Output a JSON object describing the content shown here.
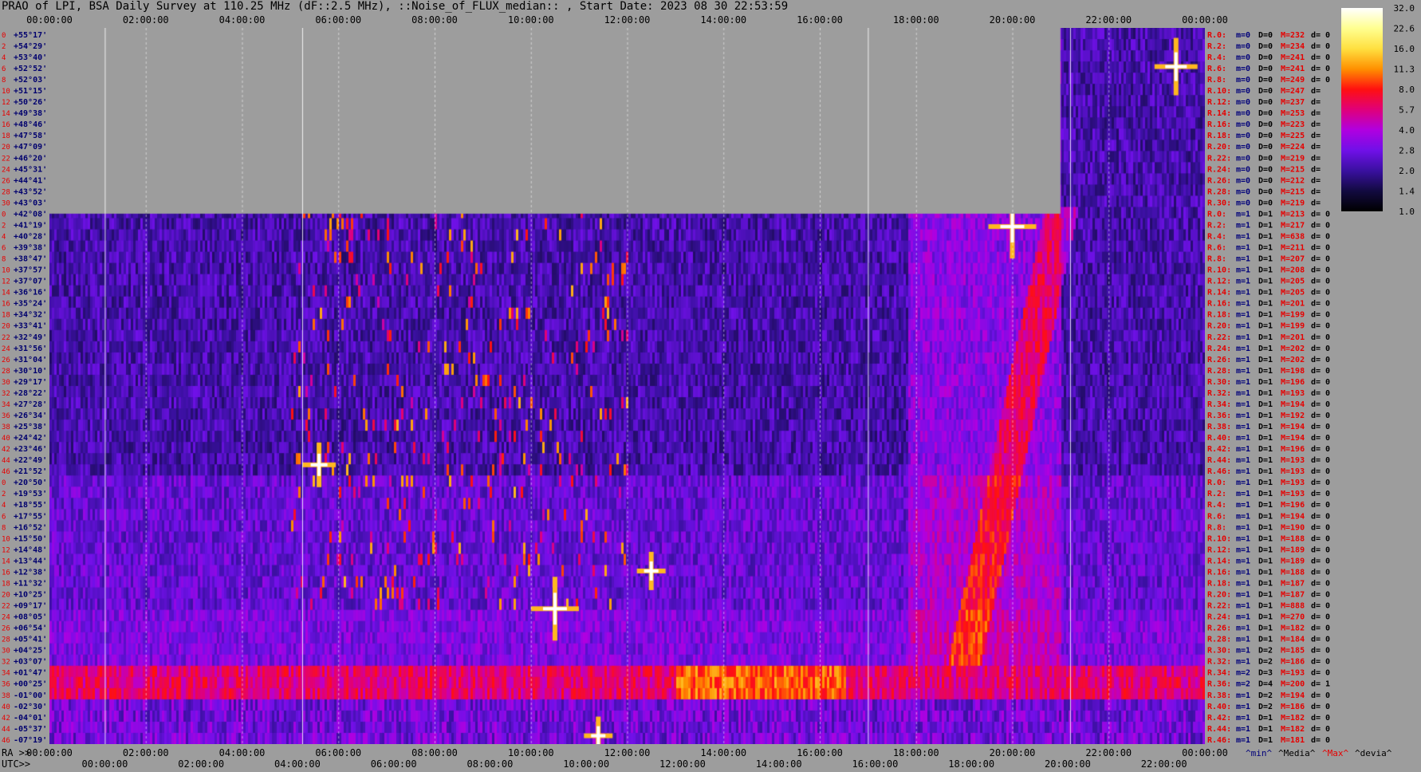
{
  "title": "PRAO of LPI, BSA Daily Survey at 110.25 MHz (dF::2.5 MHz), ::Noise_of_FLUX_median:: , Start Date: 2023 08 30 22:53:59",
  "colors": {
    "background": "#9d9d9d",
    "row_label": "#e60000",
    "dec_label": "#00006e",
    "m_label": "#00007a",
    "D_label": "#000000",
    "M_label": "#e60000"
  },
  "chart_data": {
    "type": "heatmap",
    "title": "PRAO of LPI, BSA Daily Survey at 110.25 MHz (dF::2.5 MHz), ::Noise_of_FLUX_median:: , Start Date: 2023 08 30 22:53:59",
    "top_x_ticks": [
      "00:00:00",
      "02:00:00",
      "04:00:00",
      "06:00:00",
      "08:00:00",
      "10:00:00",
      "12:00:00",
      "14:00:00",
      "16:00:00",
      "18:00:00",
      "20:00:00",
      "22:00:00",
      "00:00:00"
    ],
    "bottom_ra_label": "RA >>",
    "bottom_ra_ticks": [
      "00:00:00",
      "02:00:00",
      "04:00:00",
      "06:00:00",
      "08:00:00",
      "10:00:00",
      "12:00:00",
      "14:00:00",
      "16:00:00",
      "18:00:00",
      "20:00:00",
      "22:00:00",
      "00:00:00"
    ],
    "bottom_utc_label": "UTC>>",
    "bottom_utc_ticks": [
      "00:00:00",
      "02:00:00",
      "04:00:00",
      "06:00:00",
      "08:00:00",
      "10:00:00",
      "12:00:00",
      "14:00:00",
      "16:00:00",
      "18:00:00",
      "20:00:00",
      "22:00:00"
    ],
    "declinations": [
      "+55°17'",
      "+54°29'",
      "+53°40'",
      "+52°52'",
      "+52°03'",
      "+51°15'",
      "+50°26'",
      "+49°38'",
      "+48°46'",
      "+47°58'",
      "+47°09'",
      "+46°20'",
      "+45°31'",
      "+44°41'",
      "+43°52'",
      "+43°03'",
      "+42°08'",
      "+41°19'",
      "+40°28'",
      "+39°38'",
      "+38°47'",
      "+37°57'",
      "+37°07'",
      "+36°16'",
      "+35°24'",
      "+34°32'",
      "+33°41'",
      "+32°49'",
      "+31°56'",
      "+31°04'",
      "+30°10'",
      "+29°17'",
      "+28°22'",
      "+27°28'",
      "+26°34'",
      "+25°38'",
      "+24°42'",
      "+23°46'",
      "+22°49'",
      "+21°52'",
      "+20°50'",
      "+19°53'",
      "+18°55'",
      "+17°55'",
      "+16°52'",
      "+15°50'",
      "+14°48'",
      "+13°44'",
      "+12°38'",
      "+11°32'",
      "+10°25'",
      "+09°17'",
      "+08°05'",
      "+06°54'",
      "+05°41'",
      "+04°25'",
      "+03°07'",
      "+01°47'",
      "+00°25'",
      "-01°00'",
      "-02°30'",
      "-04°01'",
      "-05°37'",
      "-07°19'"
    ],
    "row_index_labels": [
      "0",
      "2",
      "4",
      "6",
      "8",
      "10",
      "12",
      "14",
      "16",
      "18",
      "20",
      "22",
      "24",
      "26",
      "28",
      "30",
      "0",
      "2",
      "4",
      "6",
      "8",
      "10",
      "12",
      "14",
      "16",
      "18",
      "20",
      "22",
      "24",
      "26",
      "28",
      "30",
      "32",
      "34",
      "36",
      "38",
      "40",
      "42",
      "44",
      "46",
      "0",
      "2",
      "4",
      "6",
      "8",
      "10",
      "12",
      "14",
      "16",
      "18",
      "20",
      "22",
      "24",
      "26",
      "28",
      "30",
      "32",
      "34",
      "36",
      "38",
      "40",
      "42",
      "44",
      "46"
    ],
    "stats_rows": [
      {
        "r": "R.0:",
        "m": "m=0",
        "d": "D=0",
        "M": "M=232",
        "dv": "d= 0"
      },
      {
        "r": "R.2:",
        "m": "m=0",
        "d": "D=0",
        "M": "M=234",
        "dv": "d= 0"
      },
      {
        "r": "R.4:",
        "m": "m=0",
        "d": "D=0",
        "M": "M=241",
        "dv": "d= 0"
      },
      {
        "r": "R.6:",
        "m": "m=0",
        "d": "D=0",
        "M": "M=241",
        "dv": "d= 0"
      },
      {
        "r": "R.8:",
        "m": "m=0",
        "d": "D=0",
        "M": "M=249",
        "dv": "d= 0"
      },
      {
        "r": "R.10:",
        "m": "m=0",
        "d": "D=0",
        "M": "M=247",
        "dv": "d="
      },
      {
        "r": "R.12:",
        "m": "m=0",
        "d": "D=0",
        "M": "M=237",
        "dv": "d="
      },
      {
        "r": "R.14:",
        "m": "m=0",
        "d": "D=0",
        "M": "M=253",
        "dv": "d="
      },
      {
        "r": "R.16:",
        "m": "m=0",
        "d": "D=0",
        "M": "M=223",
        "dv": "d="
      },
      {
        "r": "R.18:",
        "m": "m=0",
        "d": "D=0",
        "M": "M=225",
        "dv": "d="
      },
      {
        "r": "R.20:",
        "m": "m=0",
        "d": "D=0",
        "M": "M=224",
        "dv": "d="
      },
      {
        "r": "R.22:",
        "m": "m=0",
        "d": "D=0",
        "M": "M=219",
        "dv": "d="
      },
      {
        "r": "R.24:",
        "m": "m=0",
        "d": "D=0",
        "M": "M=215",
        "dv": "d="
      },
      {
        "r": "R.26:",
        "m": "m=0",
        "d": "D=0",
        "M": "M=212",
        "dv": "d="
      },
      {
        "r": "R.28:",
        "m": "m=0",
        "d": "D=0",
        "M": "M=215",
        "dv": "d="
      },
      {
        "r": "R.30:",
        "m": "m=0",
        "d": "D=0",
        "M": "M=219",
        "dv": "d="
      },
      {
        "r": "R.0:",
        "m": "m=1",
        "d": "D=1",
        "M": "M=213",
        "dv": "d= 0"
      },
      {
        "r": "R.2:",
        "m": "m=1",
        "d": "D=1",
        "M": "M=217",
        "dv": "d= 0"
      },
      {
        "r": "R.4:",
        "m": "m=1",
        "d": "D=1",
        "M": "M=638",
        "dv": "d= 0"
      },
      {
        "r": "R.6:",
        "m": "m=1",
        "d": "D=1",
        "M": "M=211",
        "dv": "d= 0"
      },
      {
        "r": "R.8:",
        "m": "m=1",
        "d": "D=1",
        "M": "M=207",
        "dv": "d= 0"
      },
      {
        "r": "R.10:",
        "m": "m=1",
        "d": "D=1",
        "M": "M=208",
        "dv": "d= 0"
      },
      {
        "r": "R.12:",
        "m": "m=1",
        "d": "D=1",
        "M": "M=205",
        "dv": "d= 0"
      },
      {
        "r": "R.14:",
        "m": "m=1",
        "d": "D=1",
        "M": "M=205",
        "dv": "d= 0"
      },
      {
        "r": "R.16:",
        "m": "m=1",
        "d": "D=1",
        "M": "M=201",
        "dv": "d= 0"
      },
      {
        "r": "R.18:",
        "m": "m=1",
        "d": "D=1",
        "M": "M=199",
        "dv": "d= 0"
      },
      {
        "r": "R.20:",
        "m": "m=1",
        "d": "D=1",
        "M": "M=199",
        "dv": "d= 0"
      },
      {
        "r": "R.22:",
        "m": "m=1",
        "d": "D=1",
        "M": "M=201",
        "dv": "d= 0"
      },
      {
        "r": "R.24:",
        "m": "m=1",
        "d": "D=1",
        "M": "M=202",
        "dv": "d= 0"
      },
      {
        "r": "R.26:",
        "m": "m=1",
        "d": "D=1",
        "M": "M=202",
        "dv": "d= 0"
      },
      {
        "r": "R.28:",
        "m": "m=1",
        "d": "D=1",
        "M": "M=198",
        "dv": "d= 0"
      },
      {
        "r": "R.30:",
        "m": "m=1",
        "d": "D=1",
        "M": "M=196",
        "dv": "d= 0"
      },
      {
        "r": "R.32:",
        "m": "m=1",
        "d": "D=1",
        "M": "M=193",
        "dv": "d= 0"
      },
      {
        "r": "R.34:",
        "m": "m=1",
        "d": "D=1",
        "M": "M=194",
        "dv": "d= 0"
      },
      {
        "r": "R.36:",
        "m": "m=1",
        "d": "D=1",
        "M": "M=192",
        "dv": "d= 0"
      },
      {
        "r": "R.38:",
        "m": "m=1",
        "d": "D=1",
        "M": "M=194",
        "dv": "d= 0"
      },
      {
        "r": "R.40:",
        "m": "m=1",
        "d": "D=1",
        "M": "M=194",
        "dv": "d= 0"
      },
      {
        "r": "R.42:",
        "m": "m=1",
        "d": "D=1",
        "M": "M=196",
        "dv": "d= 0"
      },
      {
        "r": "R.44:",
        "m": "m=1",
        "d": "D=1",
        "M": "M=193",
        "dv": "d= 0"
      },
      {
        "r": "R.46:",
        "m": "m=1",
        "d": "D=1",
        "M": "M=193",
        "dv": "d= 0"
      },
      {
        "r": "R.0:",
        "m": "m=1",
        "d": "D=1",
        "M": "M=193",
        "dv": "d= 0"
      },
      {
        "r": "R.2:",
        "m": "m=1",
        "d": "D=1",
        "M": "M=193",
        "dv": "d= 0"
      },
      {
        "r": "R.4:",
        "m": "m=1",
        "d": "D=1",
        "M": "M=196",
        "dv": "d= 0"
      },
      {
        "r": "R.6:",
        "m": "m=1",
        "d": "D=1",
        "M": "M=194",
        "dv": "d= 0"
      },
      {
        "r": "R.8:",
        "m": "m=1",
        "d": "D=1",
        "M": "M=190",
        "dv": "d= 0"
      },
      {
        "r": "R.10:",
        "m": "m=1",
        "d": "D=1",
        "M": "M=188",
        "dv": "d= 0"
      },
      {
        "r": "R.12:",
        "m": "m=1",
        "d": "D=1",
        "M": "M=189",
        "dv": "d= 0"
      },
      {
        "r": "R.14:",
        "m": "m=1",
        "d": "D=1",
        "M": "M=189",
        "dv": "d= 0"
      },
      {
        "r": "R.16:",
        "m": "m=1",
        "d": "D=1",
        "M": "M=188",
        "dv": "d= 0"
      },
      {
        "r": "R.18:",
        "m": "m=1",
        "d": "D=1",
        "M": "M=187",
        "dv": "d= 0"
      },
      {
        "r": "R.20:",
        "m": "m=1",
        "d": "D=1",
        "M": "M=187",
        "dv": "d= 0"
      },
      {
        "r": "R.22:",
        "m": "m=1",
        "d": "D=1",
        "M": "M=888",
        "dv": "d= 0"
      },
      {
        "r": "R.24:",
        "m": "m=1",
        "d": "D=1",
        "M": "M=270",
        "dv": "d= 0"
      },
      {
        "r": "R.26:",
        "m": "m=1",
        "d": "D=1",
        "M": "M=182",
        "dv": "d= 0"
      },
      {
        "r": "R.28:",
        "m": "m=1",
        "d": "D=1",
        "M": "M=184",
        "dv": "d= 0"
      },
      {
        "r": "R.30:",
        "m": "m=1",
        "d": "D=2",
        "M": "M=185",
        "dv": "d= 0"
      },
      {
        "r": "R.32:",
        "m": "m=1",
        "d": "D=2",
        "M": "M=186",
        "dv": "d= 0"
      },
      {
        "r": "R.34:",
        "m": "m=2",
        "d": "D=3",
        "M": "M=193",
        "dv": "d= 0"
      },
      {
        "r": "R.36:",
        "m": "m=2",
        "d": "D=4",
        "M": "M=200",
        "dv": "d= 1"
      },
      {
        "r": "R.38:",
        "m": "m=1",
        "d": "D=2",
        "M": "M=194",
        "dv": "d= 0"
      },
      {
        "r": "R.40:",
        "m": "m=1",
        "d": "D=2",
        "M": "M=186",
        "dv": "d= 0"
      },
      {
        "r": "R.42:",
        "m": "m=1",
        "d": "D=1",
        "M": "M=182",
        "dv": "d= 0"
      },
      {
        "r": "R.44:",
        "m": "m=1",
        "d": "D=1",
        "M": "M=182",
        "dv": "d= 0"
      },
      {
        "r": "R.46:",
        "m": "m=1",
        "d": "D=1",
        "M": "M=181",
        "dv": "d= 0"
      }
    ],
    "stats_footer": [
      {
        "text": "^min^",
        "color": "#00007a"
      },
      {
        "text": "^Media^",
        "color": "#000000"
      },
      {
        "text": "^Max^",
        "color": "#e60000"
      },
      {
        "text": "^devia^",
        "color": "#000000"
      }
    ],
    "colorbar": {
      "ticks": [
        "32.0",
        "22.6",
        "16.0",
        "11.3",
        "8.0",
        "5.7",
        "4.0",
        "2.8",
        "2.0",
        "1.4",
        "1.0"
      ],
      "colors": [
        "#ffffff",
        "#ffff90",
        "#ffe040",
        "#ff9000",
        "#ff1010",
        "#e0007a",
        "#b000e0",
        "#7010e8",
        "#3a10a0",
        "#120a40",
        "#000000"
      ],
      "scale": "log"
    },
    "bright_sources": [
      {
        "ra_h": 10.5,
        "dec": 8.8,
        "strength": 1.0
      },
      {
        "ra_h": 20.0,
        "dec": 41.1,
        "strength": 1.0
      },
      {
        "ra_h": 23.4,
        "dec": 52.9,
        "strength": 0.9
      },
      {
        "ra_h": 5.6,
        "dec": 22.3,
        "strength": 0.7
      },
      {
        "ra_h": 12.5,
        "dec": 12.6,
        "strength": 0.6
      },
      {
        "ra_h": 11.4,
        "dec": -6.9,
        "strength": 0.6
      }
    ],
    "masked_region": {
      "ra_from": 0.0,
      "ra_to": 21.0,
      "dec_above": 42.5
    }
  }
}
